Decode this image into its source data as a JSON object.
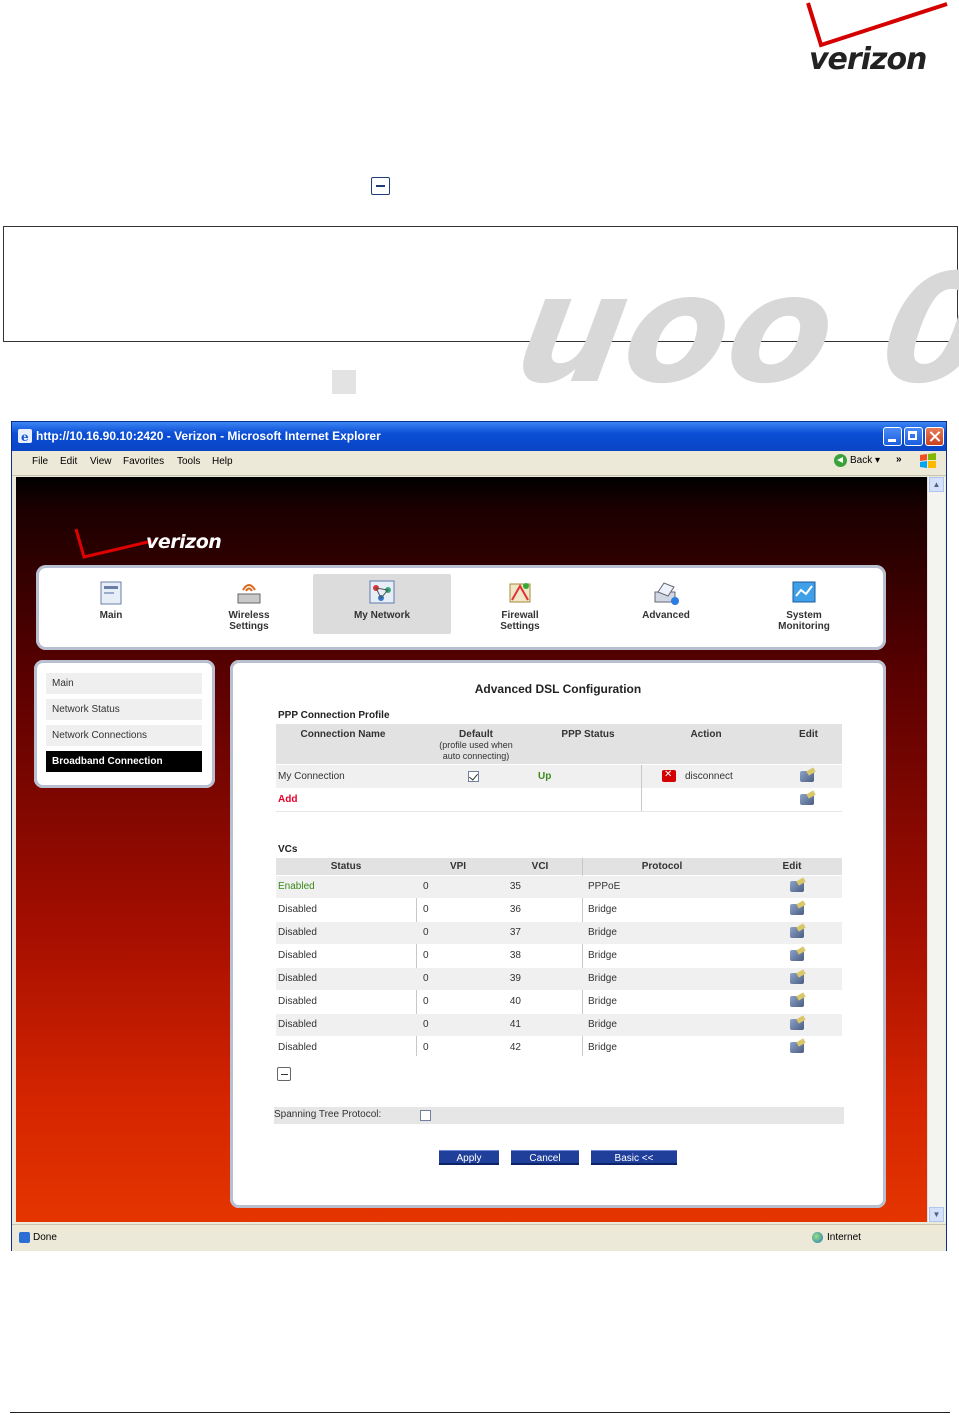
{
  "brand": {
    "name": "verizon",
    "accent_red": "#d40000",
    "nav_blue": "#1f3f9a"
  },
  "browser": {
    "title": "http://10.16.90.10:2420 - Verizon - Microsoft Internet Explorer",
    "menu": [
      "File",
      "Edit",
      "View",
      "Favorites",
      "Tools",
      "Help"
    ],
    "back_label": "Back",
    "status_left": "Done",
    "status_zone": "Internet"
  },
  "nav": {
    "tabs": [
      {
        "label_line1": "Main",
        "label_line2": "",
        "icon": "main-icon"
      },
      {
        "label_line1": "Wireless",
        "label_line2": "Settings",
        "icon": "wireless-icon"
      },
      {
        "label_line1": "My Network",
        "label_line2": "",
        "icon": "network-icon"
      },
      {
        "label_line1": "Firewall",
        "label_line2": "Settings",
        "icon": "firewall-icon"
      },
      {
        "label_line1": "Advanced",
        "label_line2": "",
        "icon": "advanced-icon"
      },
      {
        "label_line1": "System",
        "label_line2": "Monitoring",
        "icon": "monitoring-icon"
      }
    ],
    "active_tab": "My Network"
  },
  "sidebar": {
    "items": [
      "Main",
      "Network Status",
      "Network Connections",
      "Broadband Connection"
    ],
    "active_item": "Broadband Connection"
  },
  "main": {
    "title": "Advanced DSL Configuration",
    "ppp": {
      "heading": "PPP Connection Profile",
      "col_name": "Connection Name",
      "col_default_1": "Default",
      "col_default_2": "(profile used when",
      "col_default_3": "auto connecting)",
      "col_status": "PPP Status",
      "col_action": "Action",
      "col_edit": "Edit",
      "row_name": "My Connection",
      "row_status": "Up",
      "row_action": "disconnect",
      "add_label": "Add"
    },
    "vcs": {
      "heading": "VCs",
      "columns": [
        "Status",
        "VPI",
        "VCI",
        "Protocol",
        "Edit"
      ],
      "rows": [
        {
          "status": "Enabled",
          "vpi": "0",
          "vci": "35",
          "protocol": "PPPoE"
        },
        {
          "status": "Disabled",
          "vpi": "0",
          "vci": "36",
          "protocol": "Bridge"
        },
        {
          "status": "Disabled",
          "vpi": "0",
          "vci": "37",
          "protocol": "Bridge"
        },
        {
          "status": "Disabled",
          "vpi": "0",
          "vci": "38",
          "protocol": "Bridge"
        },
        {
          "status": "Disabled",
          "vpi": "0",
          "vci": "39",
          "protocol": "Bridge"
        },
        {
          "status": "Disabled",
          "vpi": "0",
          "vci": "40",
          "protocol": "Bridge"
        },
        {
          "status": "Disabled",
          "vpi": "0",
          "vci": "41",
          "protocol": "Bridge"
        },
        {
          "status": "Disabled",
          "vpi": "0",
          "vci": "42",
          "protocol": "Bridge"
        }
      ]
    },
    "stp_label": "Spanning Tree Protocol:",
    "buttons": {
      "apply": "Apply",
      "cancel": "Cancel",
      "basic": "Basic <<"
    }
  }
}
